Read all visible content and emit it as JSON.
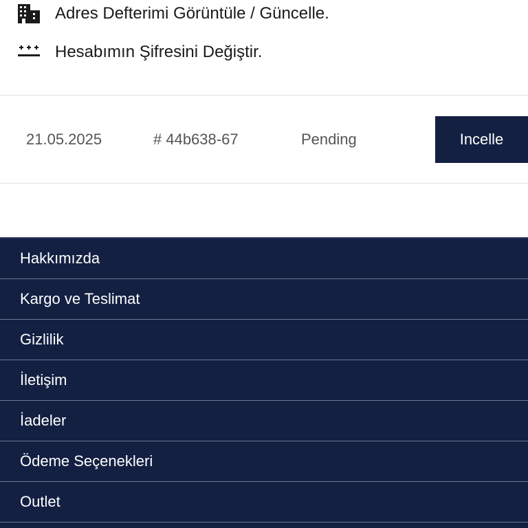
{
  "account_links": [
    {
      "icon": "building-icon",
      "label": "Adres Defterimi Görüntüle / Güncelle."
    },
    {
      "icon": "password-icon",
      "label": "Hesabımın Şifresini Değiştir."
    }
  ],
  "order": {
    "date": "21.05.2025",
    "id": "# 44b638-67",
    "status": "Pending",
    "action_label": "Incelle"
  },
  "footer": {
    "items": [
      {
        "label": "Hakkımızda"
      },
      {
        "label": "Kargo ve Teslimat"
      },
      {
        "label": "Gizlilik"
      },
      {
        "label": "İletişim"
      },
      {
        "label": "İadeler"
      },
      {
        "label": "Ödeme Seçenekleri"
      },
      {
        "label": "Outlet"
      }
    ]
  },
  "colors": {
    "navy": "#132042",
    "text_dark": "#1a1a1a",
    "text_muted": "#555555"
  }
}
